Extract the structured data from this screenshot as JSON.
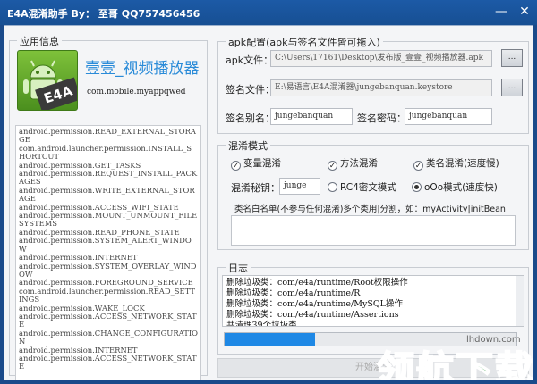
{
  "window": {
    "title": "E4A混淆助手 By： 至哥 QQ757456456",
    "minimize": "—",
    "close": "✕"
  },
  "app_info": {
    "group_title": "应用信息",
    "icon_text": "E4A",
    "app_name": "壹壹_视频播放器",
    "package": "com.mobile.myappqwed",
    "permissions": [
      "android.permission.READ_EXTERNAL_STORAGE",
      "com.android.launcher.permission.INSTALL_SHORTCUT",
      "android.permission.GET_TASKS",
      "android.permission.REQUEST_INSTALL_PACKAGES",
      "android.permission.WRITE_EXTERNAL_STORAGE",
      "android.permission.ACCESS_WIFI_STATE",
      "android.permission.MOUNT_UNMOUNT_FILESYSTEMS",
      "android.permission.READ_PHONE_STATE",
      "android.permission.SYSTEM_ALERT_WINDOW",
      "android.permission.INTERNET",
      "android.permission.SYSTEM_OVERLAY_WINDOW",
      "android.permission.FOREGROUND_SERVICE",
      "com.android.launcher.permission.READ_SETTINGS",
      "android.permission.WAKE_LOCK",
      "android.permission.ACCESS_NETWORK_STATE",
      "android.permission.CHANGE_CONFIGURATION",
      "android.permission.INTERNET",
      "android.permission.ACCESS_NETWORK_STATE"
    ]
  },
  "apk_config": {
    "group_title": "apk配置(apk与签名文件皆可拖入)",
    "apk_label": "apk文件：",
    "apk_path": "C:\\Users\\17161\\Desktop\\发布版_壹壹_视频播放器.apk",
    "sign_label": "签名文件：",
    "sign_path": "E:\\易语言\\E4A混淆器\\jungebanquan.keystore",
    "browse": "...",
    "alias_label": "签名别名：",
    "alias_value": "jungebanquan",
    "password_label": "签名密码：",
    "password_value": "jungebanquan"
  },
  "obfuscation": {
    "group_title": "混淆模式",
    "check_var": "变量混淆",
    "check_method": "方法混淆",
    "check_class": "类名混淆(速度慢)",
    "key_label": "混淆秘钥：",
    "key_value": "junge",
    "mode_rc4": "RC4密文模式",
    "mode_oooo": "oOo模式(速度快)",
    "whitelist_label": "类名白名单(不参与任何混淆)多个类用|分割，如：myActivity|initBean"
  },
  "log": {
    "group_title": "日志",
    "lines": [
      "删除垃圾类：com/e4a/runtime/Root权限操作",
      "删除垃圾类：com/e4a/runtime/R",
      "删除垃圾类：com/e4a/runtime/MySQL操作",
      "删除垃圾类：com/e4a/runtime/Assertions",
      "共清理39个垃圾类"
    ],
    "progress": 0.31,
    "start_button": "开始混淆"
  },
  "watermark": {
    "text": "领航下载",
    "url": "lhdown.com",
    "color": "#1e8f2e"
  }
}
